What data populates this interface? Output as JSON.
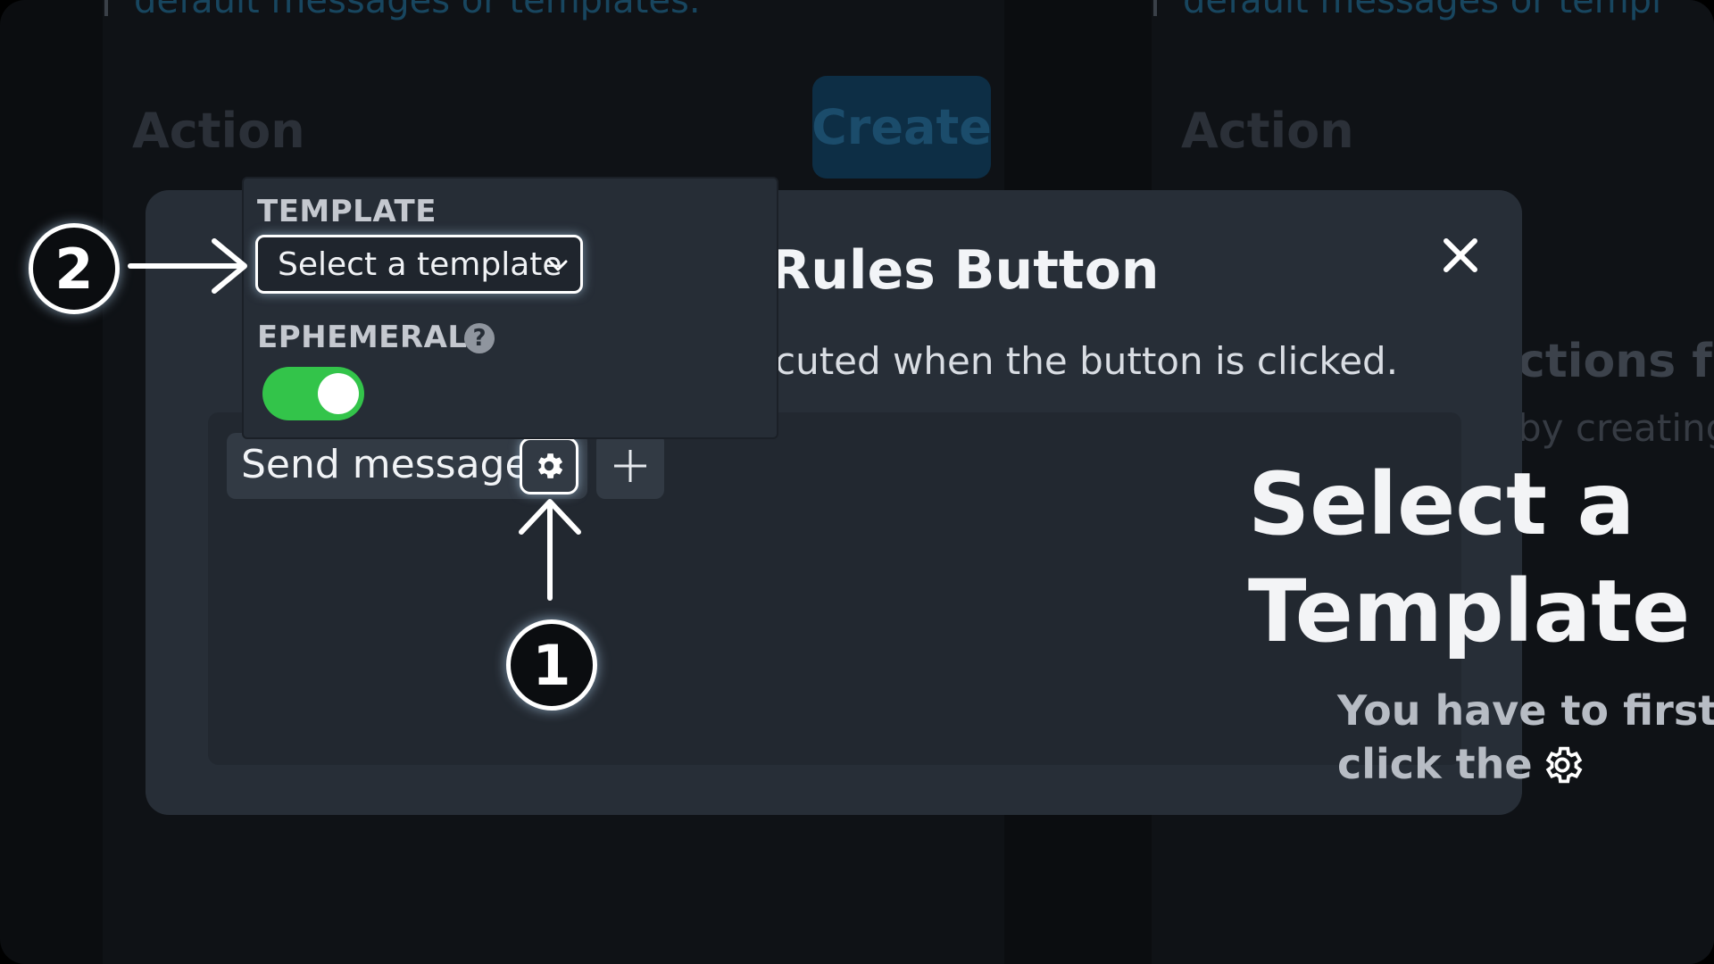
{
  "background": {
    "links_left": "default messages or templates.",
    "links_right": "default messages or templ",
    "action_left": "Action",
    "action_right": "Action",
    "create_button": "Create",
    "partial_heading": "ctions fo",
    "partial_sub": "by creating"
  },
  "modal": {
    "title": "Rules Button",
    "description": "cuted when the button is clicked.",
    "action_chip_label": "Send message"
  },
  "popover": {
    "template_label": "TEMPLATE",
    "select_value": "Select a template",
    "ephemeral_label": "EPHEMERAL",
    "ephemeral_help": "?",
    "ephemeral_on": true
  },
  "annotations": {
    "step1": "1",
    "step2": "2",
    "heading_line1": "Select a",
    "heading_line2": "Template",
    "note_line1": "You have to first",
    "note_line2": "click the"
  },
  "colors": {
    "toggle_on": "#33c44a",
    "modal_bg": "#272e37",
    "highlight": "#ffffff"
  },
  "icons": [
    "close-icon",
    "gear-icon",
    "plus-icon",
    "chevron-down-icon",
    "help-icon",
    "arrow-right-icon",
    "arrow-up-icon"
  ]
}
